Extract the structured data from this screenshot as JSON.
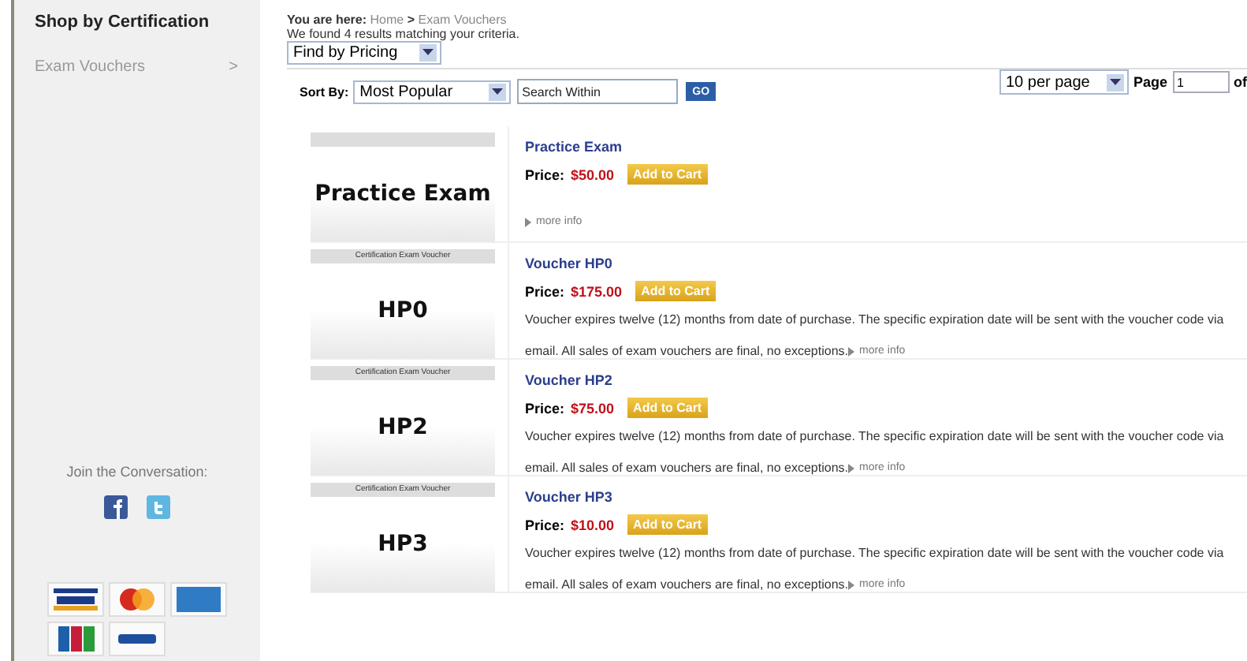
{
  "sidebar": {
    "heading": "Shop by Certification",
    "items": [
      {
        "label": "Exam Vouchers",
        "arrow": ">"
      }
    ],
    "social_heading": "Join the Conversation:"
  },
  "breadcrumb": {
    "prefix": "You are here:",
    "path": [
      "Home",
      "Exam Vouchers"
    ],
    "separator": ">"
  },
  "results_text": "We found 4 results matching your criteria.",
  "filter_select": "Find by Pricing",
  "sort": {
    "label": "Sort By:",
    "value": "Most Popular"
  },
  "search": {
    "placeholder": "Search Within",
    "button": "GO"
  },
  "pagination": {
    "per_page": "10 per page",
    "page_label": "Page",
    "page": "1",
    "of": "of"
  },
  "products": [
    {
      "image_title": "Practice Exam",
      "title": "Practice Exam",
      "price_label": "Price:",
      "price": "$50.00",
      "button": "Add to Cart",
      "more": "more info"
    },
    {
      "banner": "Certification Exam Voucher",
      "image_title": "HP0",
      "title": "Voucher HP0",
      "price_label": "Price:",
      "price": "$175.00",
      "button": "Add to Cart",
      "description_lines": [
        "Voucher expires twelve (12) months from date of purchase. The specific expiration date will be sent with the voucher code via",
        "email. All sales of exam vouchers are final, no exceptions."
      ],
      "more": "more info"
    },
    {
      "banner": "Certification Exam Voucher",
      "image_title": "HP2",
      "title": "Voucher HP2",
      "price_label": "Price:",
      "price": "$75.00",
      "button": "Add to Cart",
      "description_lines": [
        "Voucher expires twelve (12) months from date of purchase. The specific expiration date will be sent with the voucher code via",
        "email. All sales of exam vouchers are final, no exceptions."
      ],
      "more": "more info"
    },
    {
      "banner": "Certification Exam Voucher",
      "image_title": "HP3",
      "title": "Voucher HP3",
      "price_label": "Price:",
      "price": "$10.00",
      "button": "Add to Cart",
      "description_lines": [
        "Voucher expires twelve (12) months from date of purchase. The specific expiration date will be sent with the voucher code via",
        "email. All sales of exam vouchers are final, no exceptions."
      ],
      "more": "more info"
    }
  ]
}
